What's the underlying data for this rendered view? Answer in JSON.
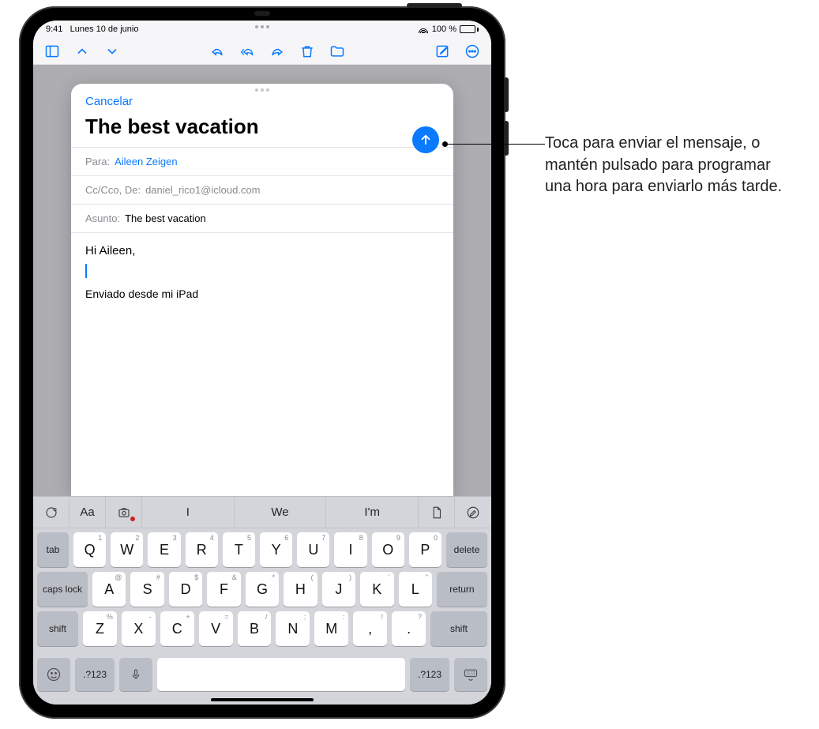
{
  "status": {
    "time": "9:41",
    "date": "Lunes 10 de junio",
    "battery": "100 %"
  },
  "sheet": {
    "cancel": "Cancelar",
    "title": "The best vacation",
    "to_label": "Para:",
    "to_value": "Aileen Zeigen",
    "cc_label": "Cc/Cco, De:",
    "cc_value": "daniel_rico1@icloud.com",
    "subject_label": "Asunto:",
    "subject_value": "The best vacation",
    "body_greeting": "Hi Aileen,",
    "signature": "Enviado desde mi iPad"
  },
  "callout": {
    "text": "Toca para enviar el mensaje, o mantén pulsado para programar una hora para enviarlo más tarde."
  },
  "keyboard": {
    "suggestions": [
      "I",
      "We",
      "I'm"
    ],
    "row1": [
      {
        "k": "Q",
        "s": "1"
      },
      {
        "k": "W",
        "s": "2"
      },
      {
        "k": "E",
        "s": "3"
      },
      {
        "k": "R",
        "s": "4"
      },
      {
        "k": "T",
        "s": "5"
      },
      {
        "k": "Y",
        "s": "6"
      },
      {
        "k": "U",
        "s": "7"
      },
      {
        "k": "I",
        "s": "8"
      },
      {
        "k": "O",
        "s": "9"
      },
      {
        "k": "P",
        "s": "0"
      }
    ],
    "row2": [
      {
        "k": "A",
        "s": "@"
      },
      {
        "k": "S",
        "s": "#"
      },
      {
        "k": "D",
        "s": "$"
      },
      {
        "k": "F",
        "s": "&"
      },
      {
        "k": "G",
        "s": "*"
      },
      {
        "k": "H",
        "s": "("
      },
      {
        "k": "J",
        "s": ")"
      },
      {
        "k": "K",
        "s": "'"
      },
      {
        "k": "L",
        "s": "\""
      }
    ],
    "row3": [
      {
        "k": "Z",
        "s": "%"
      },
      {
        "k": "X",
        "s": "-"
      },
      {
        "k": "C",
        "s": "+"
      },
      {
        "k": "V",
        "s": "="
      },
      {
        "k": "B",
        "s": "/"
      },
      {
        "k": "N",
        "s": ";"
      },
      {
        "k": "M",
        "s": ":"
      },
      {
        "k": ",",
        "s": "!"
      },
      {
        "k": ".",
        "s": "?"
      }
    ],
    "mods": {
      "tab": "tab",
      "delete": "delete",
      "caps": "caps lock",
      "return": "return",
      "shift": "shift",
      "numsym": ".?123"
    }
  }
}
